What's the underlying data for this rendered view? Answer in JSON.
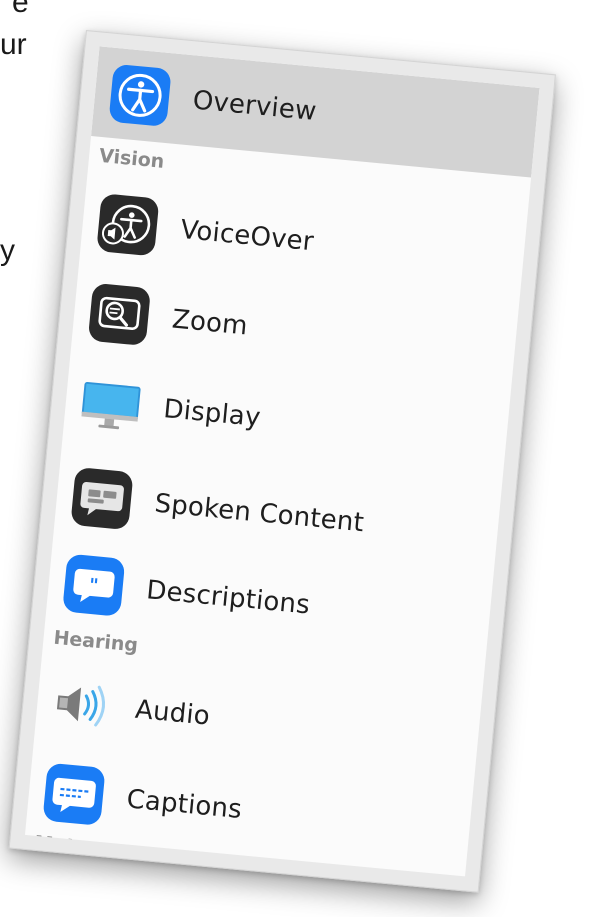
{
  "background_text": [
    "e",
    "ur",
    "y"
  ],
  "sidebar": {
    "items": [
      {
        "label": "Overview",
        "icon": "accessibility-icon",
        "selected": true
      },
      {
        "label": "VoiceOver",
        "icon": "voiceover-icon"
      },
      {
        "label": "Zoom",
        "icon": "zoom-icon"
      },
      {
        "label": "Display",
        "icon": "display-icon"
      },
      {
        "label": "Spoken Content",
        "icon": "spoken-content-icon"
      },
      {
        "label": "Descriptions",
        "icon": "descriptions-icon"
      },
      {
        "label": "Audio",
        "icon": "speaker-icon"
      },
      {
        "label": "Captions",
        "icon": "captions-icon"
      }
    ],
    "sections": {
      "vision": "Vision",
      "hearing": "Hearing",
      "motor": "Motor"
    }
  },
  "colors": {
    "selected_bg": "#d3d3d3",
    "accent_blue": "#1a7cf5",
    "icon_dark": "#2a2a2a",
    "section_text": "#8a8a8a"
  }
}
